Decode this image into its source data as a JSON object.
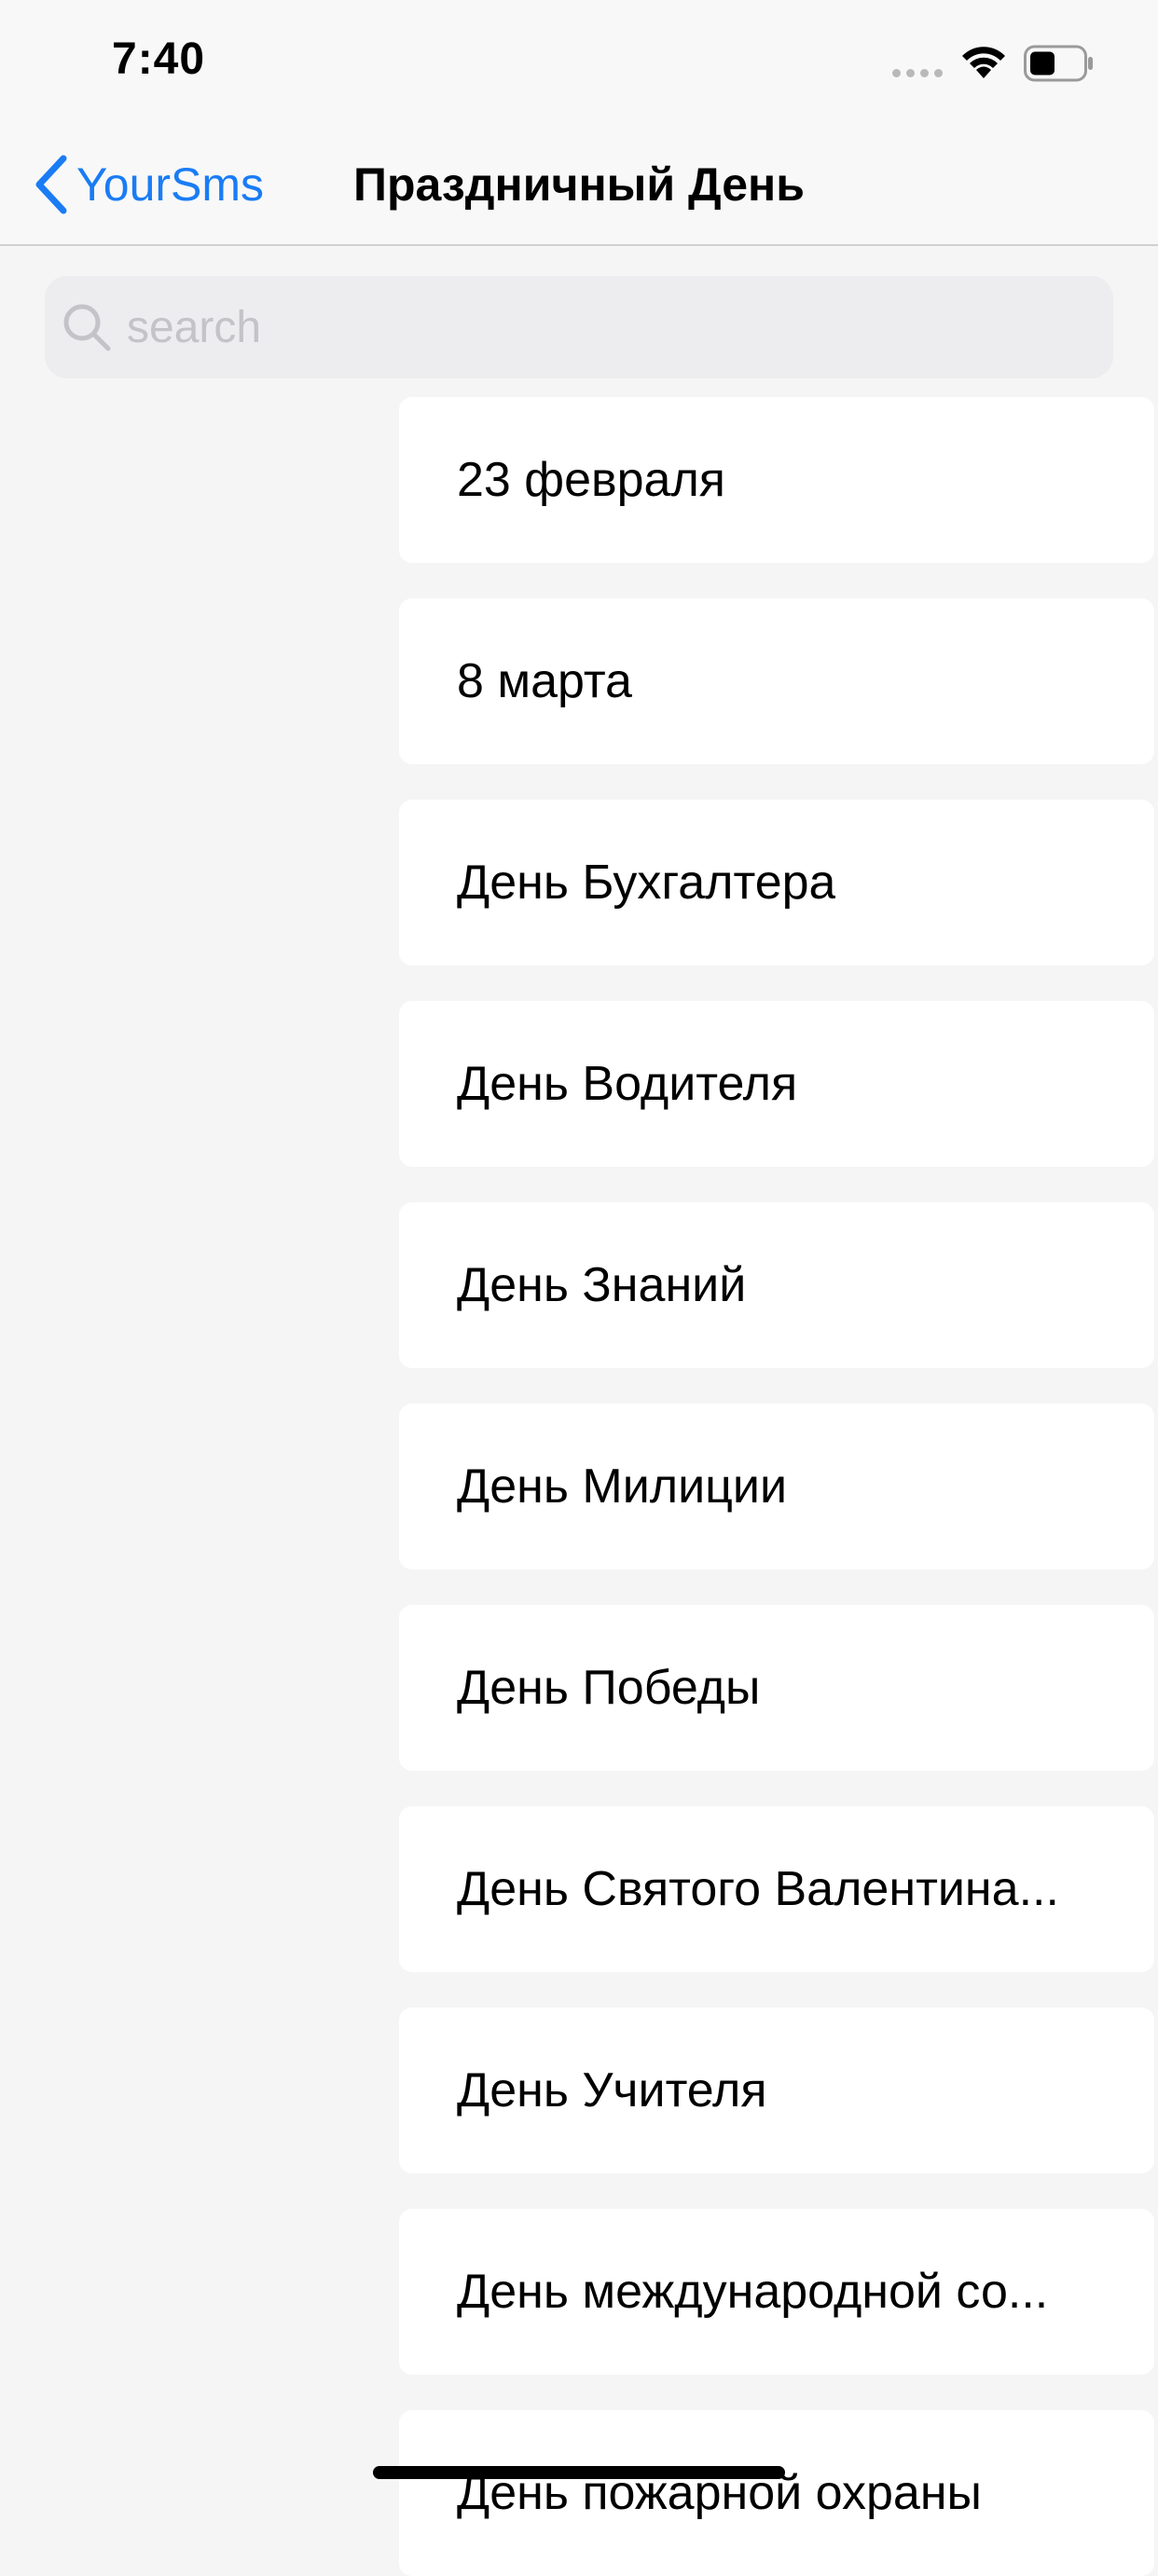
{
  "status_bar": {
    "time": "7:40"
  },
  "nav": {
    "back_label": "YourSms",
    "title": "Праздничный День"
  },
  "search": {
    "placeholder": "search",
    "value": ""
  },
  "holidays": [
    "23 февраля",
    "8 марта",
    "День Бухгалтера",
    "День Водителя",
    "День Знаний",
    "День Милиции",
    "День Победы",
    "День Святого Валентина...",
    "День Учителя",
    "День международной со...",
    "День пожарной охраны"
  ],
  "colors": {
    "accent": "#1a7cf5",
    "background": "#f5f5f5",
    "cell": "#ffffff",
    "search_field": "#ededf0"
  }
}
